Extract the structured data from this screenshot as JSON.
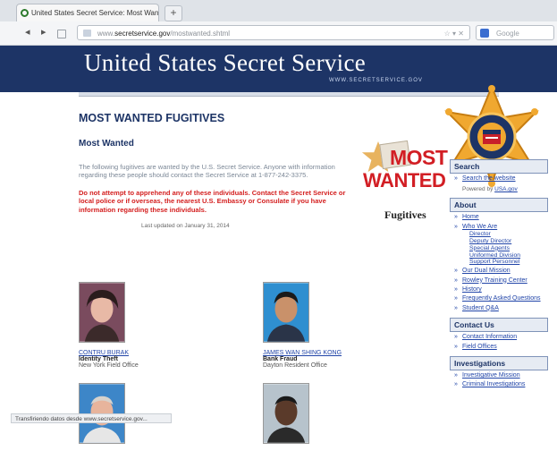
{
  "browser": {
    "tab_title": "United States Secret Service: Most Wanted",
    "new_tab": "+",
    "back": "◂",
    "forward": "▸",
    "url_prefix": "www.",
    "url_domain": "secretservice.gov",
    "url_path": "/mostwanted.shtml",
    "url_actions": "☆ ▾ ✕",
    "search_placeholder": "Google",
    "status_text": "Transfiriendo datos desde www.secretservice.gov..."
  },
  "site": {
    "title": "United States Secret Service",
    "banner_url": "WWW.SECRETSERVICE.GOV",
    "badge_text": "UNITED STATES SECRET SERVICE"
  },
  "main": {
    "heading": "MOST WANTED FUGITIVES",
    "subheading": "Most Wanted",
    "intro": "The following fugitives are wanted by the U.S. Secret Service. Anyone with information regarding these people should contact the Secret Service at 1-877-242-3375.",
    "warning": "Do not attempt to apprehend any of these individuals. Contact the Secret Service or local police or if overseas, the nearest U.S. Embassy or Consulate if you have information regarding these individuals.",
    "updated": "Last updated on January 31, 2014"
  },
  "most_wanted_logo": {
    "most": "MOST",
    "wanted": "WANTED",
    "fugitives": "Fugitives"
  },
  "fugitives": [
    {
      "name": "CONTRU BURAK",
      "crime": "Identity Theft",
      "office": "New York Field Office"
    },
    {
      "name": "JAMES WAN SHING KONG",
      "crime": "Bank Fraud",
      "office": "Dayton Resident Office"
    },
    {
      "name": "",
      "crime": "",
      "office": ""
    },
    {
      "name": "",
      "crime": "",
      "office": ""
    }
  ],
  "sidebar": {
    "search": {
      "heading": "Search",
      "link": "Search the website",
      "powered_label": "Powered by",
      "powered_link": "USA.gov"
    },
    "about": {
      "heading": "About",
      "items": [
        "Home",
        "Who We Are"
      ],
      "sub": [
        "Director",
        "Deputy Director",
        "Special Agents",
        "Uniformed Division",
        "Support Personnel"
      ],
      "items2": [
        "Our Dual Mission",
        "Rowley Training Center",
        "History",
        "Frequently Asked Questions",
        "Student Q&A"
      ]
    },
    "contact": {
      "heading": "Contact Us",
      "items": [
        "Contact Information",
        "Field Offices"
      ]
    },
    "investigations": {
      "heading": "Investigations",
      "items": [
        "Investigative Mission",
        "Criminal Investigations"
      ]
    }
  },
  "colors": {
    "banner": "#1d3466",
    "accent_red": "#d21e24",
    "link": "#2145a8"
  }
}
